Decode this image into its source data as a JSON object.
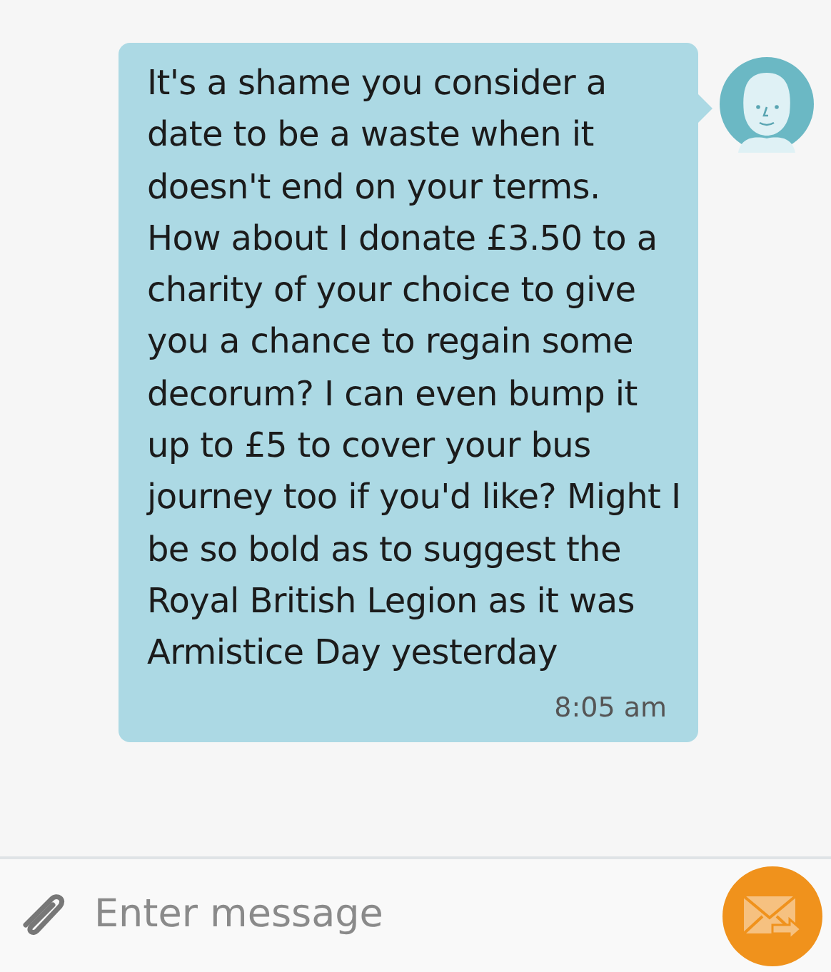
{
  "messages": [
    {
      "text": "It's a shame you consider a date to be a waste when it doesn't end on your terms. How about I donate £3.50 to a charity of your choice to give you a chance to regain some decorum? I can even bump it up to £5 to cover your bus journey too if you'd like? Might I be so bold as to suggest the Royal British Legion as it was Armistice Day yesterday",
      "time": "8:05 am"
    }
  ],
  "composer": {
    "placeholder": "Enter message"
  }
}
